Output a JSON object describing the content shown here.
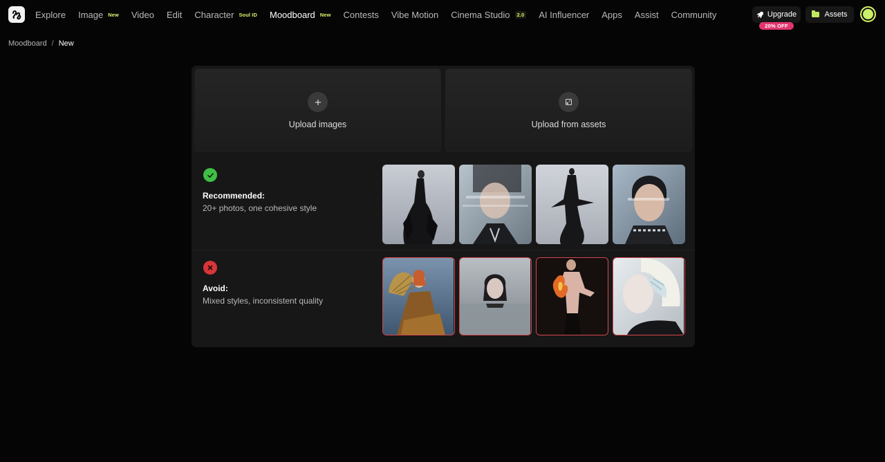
{
  "nav": {
    "items": [
      {
        "label": "Explore",
        "badge": "",
        "active": false
      },
      {
        "label": "Image",
        "badge": "New",
        "active": false
      },
      {
        "label": "Video",
        "badge": "",
        "active": false
      },
      {
        "label": "Edit",
        "badge": "",
        "active": false
      },
      {
        "label": "Character",
        "badge": "Soul ID",
        "active": false
      },
      {
        "label": "Moodboard",
        "badge": "New",
        "active": true
      },
      {
        "label": "Contests",
        "badge": "",
        "active": false
      },
      {
        "label": "Vibe Motion",
        "badge": "",
        "active": false
      },
      {
        "label": "Cinema Studio",
        "badge": "2.0",
        "active": false
      },
      {
        "label": "AI Influencer",
        "badge": "",
        "active": false
      },
      {
        "label": "Apps",
        "badge": "",
        "active": false
      },
      {
        "label": "Assist",
        "badge": "",
        "active": false
      },
      {
        "label": "Community",
        "badge": "",
        "active": false
      }
    ],
    "upgrade_label": "Upgrade",
    "promo_label": "20% OFF",
    "assets_label": "Assets",
    "accent_color": "#d4ef5e",
    "promo_color": "#e2356f"
  },
  "breadcrumb": {
    "parent": "Moodboard",
    "separator": "/",
    "current": "New"
  },
  "upload": {
    "images_label": "Upload images",
    "assets_label": "Upload from assets"
  },
  "recommended": {
    "title": "Recommended:",
    "description": "20+ photos, one cohesive style",
    "icon": "check-icon",
    "color": "#3fbf45"
  },
  "avoid": {
    "title": "Avoid:",
    "description": "Mixed styles, inconsistent quality",
    "icon": "x-icon",
    "color": "#d8353a"
  }
}
